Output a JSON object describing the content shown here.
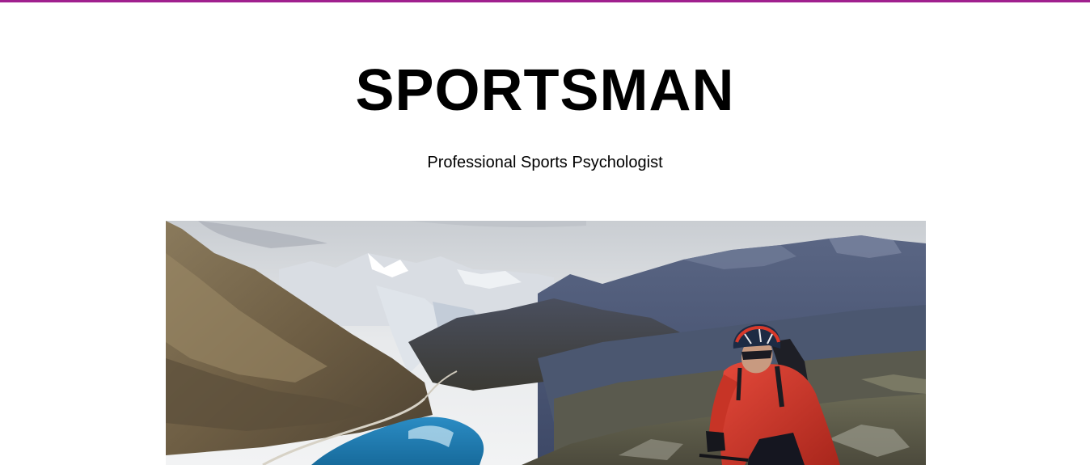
{
  "header": {
    "title": "SPORTSMAN",
    "tagline": "Professional Sports Psychologist"
  },
  "hero_image": {
    "icon": "mountain-cyclist-photo"
  },
  "colors": {
    "accent": "#a0208e",
    "background": "#ffffff",
    "text": "#000000",
    "jacket": "#d8392a",
    "lake": "#1f7fb5"
  }
}
